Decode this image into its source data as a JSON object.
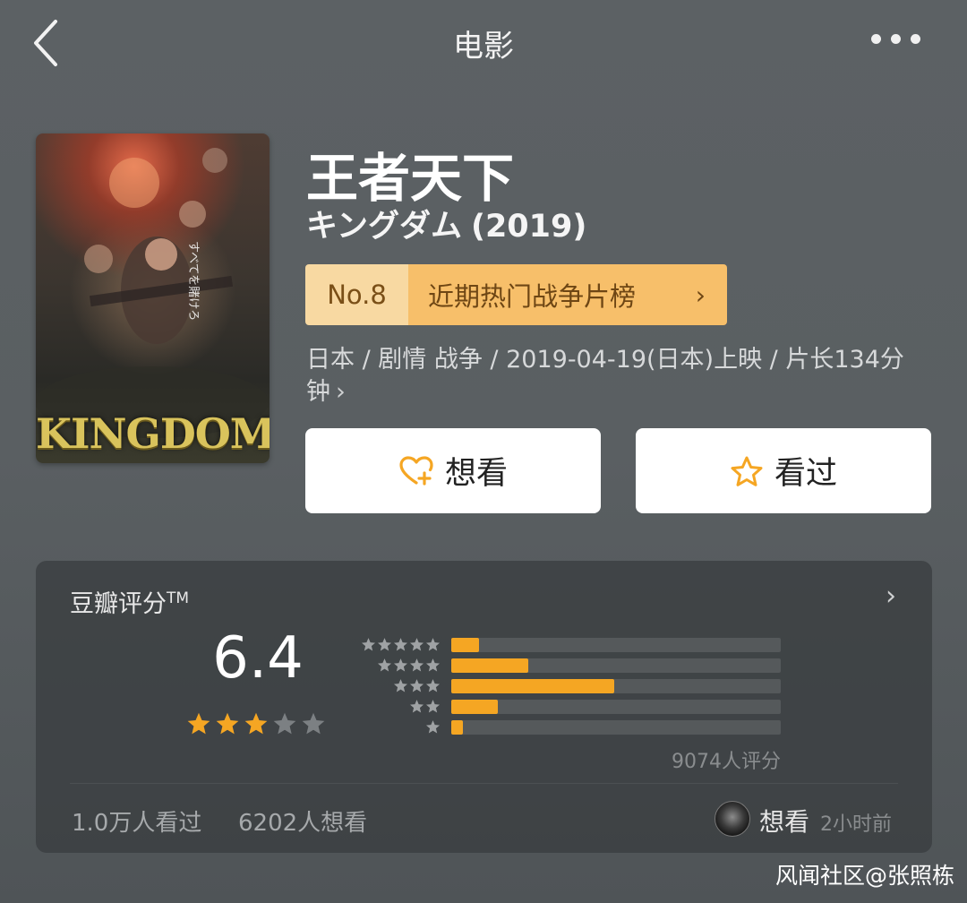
{
  "header": {
    "title": "电影",
    "back_icon": "chevron-left-icon",
    "more_icon": "more-dots-icon"
  },
  "movie": {
    "title": "王者天下",
    "original_title": "キングダム",
    "year": "(2019)",
    "poster_logo": "KINGDOM",
    "rank": {
      "number": "No.8",
      "list_name": "近期热门战争片榜",
      "chevron": "›"
    },
    "meta": "日本 / 剧情 战争 / 2019-04-19(日本)上映 / 片长134分钟",
    "meta_chevron": "›"
  },
  "actions": {
    "want_label": "想看",
    "want_icon": "heart-plus-icon",
    "seen_label": "看过",
    "seen_icon": "star-outline-icon"
  },
  "rating": {
    "label": "豆瓣评分",
    "tm": "TM",
    "chevron": "›",
    "score": "6.4",
    "stars_filled": 3,
    "stars_total": 5,
    "distribution": [
      {
        "stars": 5,
        "fraction": 0.085
      },
      {
        "stars": 4,
        "fraction": 0.235
      },
      {
        "stars": 3,
        "fraction": 0.495
      },
      {
        "stars": 2,
        "fraction": 0.14
      },
      {
        "stars": 1,
        "fraction": 0.035
      }
    ],
    "count_text": "9074人评分",
    "seen_text": "1.0万人看过",
    "want_text": "6202人想看",
    "friend_action": "想看",
    "friend_time": "2小时前"
  },
  "colors": {
    "accent_orange": "#f5a623",
    "rank_left": "#f8d9a2",
    "rank_right": "#f7bf6a",
    "star_empty": "#7c8083"
  },
  "watermark": "风闻社区@张照栋"
}
